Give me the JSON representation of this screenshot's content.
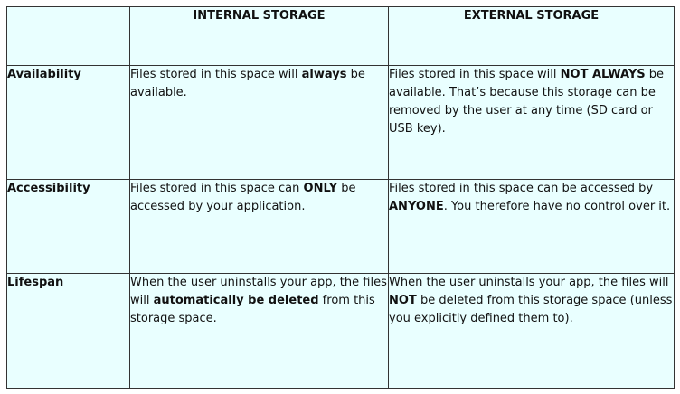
{
  "columns": [
    "",
    "INTERNAL STORAGE",
    "EXTERNAL STORAGE"
  ],
  "rows": [
    {
      "label": "Availability",
      "internal": [
        {
          "t": "Files stored in this space will ",
          "b": false
        },
        {
          "t": "always",
          "b": true
        },
        {
          "t": " be available.",
          "b": false
        }
      ],
      "external": [
        {
          "t": "Files stored in this space will ",
          "b": false
        },
        {
          "t": "NOT ALWAYS",
          "b": true
        },
        {
          "t": " be available.  That’s because this storage can be removed by the user at any time (SD card or USB key).",
          "b": false
        }
      ]
    },
    {
      "label": "Accessibility",
      "internal": [
        {
          "t": "Files stored in this space can ",
          "b": false
        },
        {
          "t": "ONLY",
          "b": true
        },
        {
          "t": " be accessed  by your application.",
          "b": false
        }
      ],
      "external": [
        {
          "t": "Files stored in this space  can be accessed  by ",
          "b": false
        },
        {
          "t": "ANYONE",
          "b": true
        },
        {
          "t": ". You therefore have no control over it.",
          "b": false
        }
      ]
    },
    {
      "label": "Lifespan",
      "internal": [
        {
          "t": "When the user uninstalls your app, the files will ",
          "b": false
        },
        {
          "t": "automatically be deleted",
          "b": true
        },
        {
          "t": " from this storage space.",
          "b": false
        }
      ],
      "external": [
        {
          "t": "When the user uninstalls your app, the files will ",
          "b": false
        },
        {
          "t": "NOT",
          "b": true
        },
        {
          "t": " be deleted from this storage space (unless you explicitly defined them to).",
          "b": false
        }
      ]
    }
  ]
}
